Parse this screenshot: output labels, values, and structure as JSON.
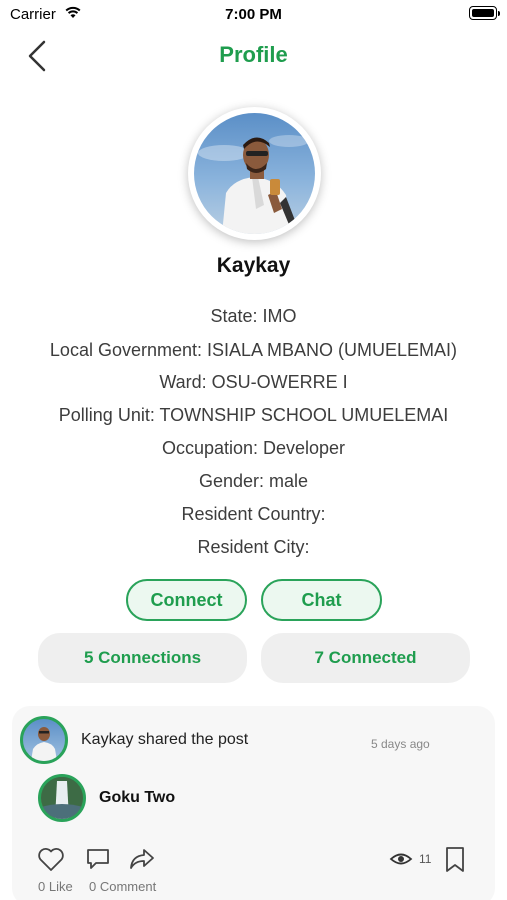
{
  "status_bar": {
    "carrier": "Carrier",
    "time": "7:00 PM"
  },
  "nav": {
    "title": "Profile",
    "back_icon": "chevron-left-icon"
  },
  "profile": {
    "name": "Kaykay",
    "details": [
      "State: IMO",
      "Local Government: ISIALA MBANO (UMUELEMAI)",
      "Ward: OSU-OWERRE I",
      "Polling Unit: TOWNSHIP SCHOOL UMUELEMAI",
      "Occupation: Developer",
      "Gender: male",
      "Resident Country:",
      "Resident City:"
    ]
  },
  "actions": {
    "connect_label": "Connect",
    "chat_label": "Chat"
  },
  "stats": {
    "connections_label": "5 Connections",
    "connected_label": "7 Connected"
  },
  "post": {
    "shared_text": "Kaykay shared the post",
    "time": "5 days ago",
    "author": "Goku Two",
    "views": "11",
    "likes_label": "0 Like",
    "comments_label": "0 Comment"
  },
  "colors": {
    "accent": "#1f9d4e",
    "accent_border": "#2aa35a",
    "pill_bg": "#ecf8f0",
    "stat_bg": "#efefef"
  }
}
